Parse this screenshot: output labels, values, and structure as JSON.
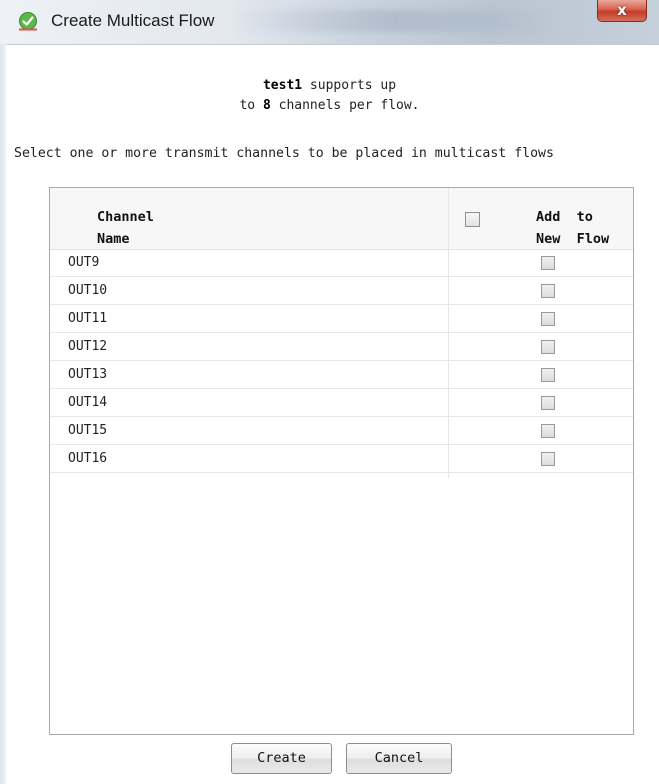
{
  "window": {
    "title": "Create Multicast Flow",
    "close_label": "x"
  },
  "info": {
    "device": "test1",
    "line1_suffix": " supports up",
    "line2_prefix": "to ",
    "max_channels": "8",
    "line2_suffix": " channels per flow."
  },
  "instruction": "Select one or more transmit channels to be placed in multicast flows",
  "table": {
    "col_name_header": "Channel\nName",
    "col_add_header": "Add  to\nNew  Flow",
    "rows": [
      {
        "name": "OUT9",
        "checked": false
      },
      {
        "name": "OUT10",
        "checked": false
      },
      {
        "name": "OUT11",
        "checked": false
      },
      {
        "name": "OUT12",
        "checked": false
      },
      {
        "name": "OUT13",
        "checked": false
      },
      {
        "name": "OUT14",
        "checked": false
      },
      {
        "name": "OUT15",
        "checked": false
      },
      {
        "name": "OUT16",
        "checked": false
      }
    ]
  },
  "buttons": {
    "create": "Create",
    "cancel": "Cancel"
  },
  "colors": {
    "close_button": "#c33c26",
    "app_icon": "#4caf3a"
  }
}
